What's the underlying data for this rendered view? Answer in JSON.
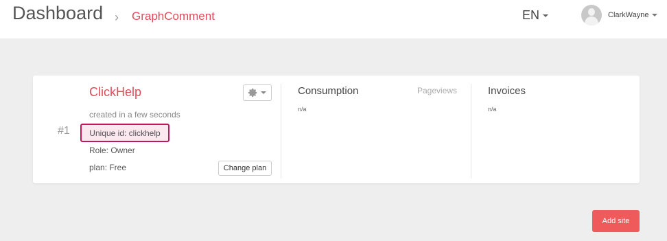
{
  "header": {
    "title": "Dashboard",
    "breadcrumb_separator": "›",
    "breadcrumb": "GraphComment",
    "language": "EN",
    "username": "ClarkWayne"
  },
  "site": {
    "number": "#1",
    "name": "ClickHelp",
    "created": "created in a few seconds",
    "unique_id": "Unique id: clickhelp",
    "role": "Role: Owner",
    "plan": "plan: Free",
    "change_plan_label": "Change plan",
    "settings_icon": "gear-icon"
  },
  "consumption": {
    "title": "Consumption",
    "metric": "Pageviews",
    "value": "n/a"
  },
  "invoices": {
    "title": "Invoices",
    "value": "n/a"
  },
  "actions": {
    "add_site_label": "Add site"
  },
  "colors": {
    "accent": "#e24a58",
    "add_button": "#ef5b5b",
    "highlight_border": "#c2185b",
    "background": "#eeeeee"
  }
}
